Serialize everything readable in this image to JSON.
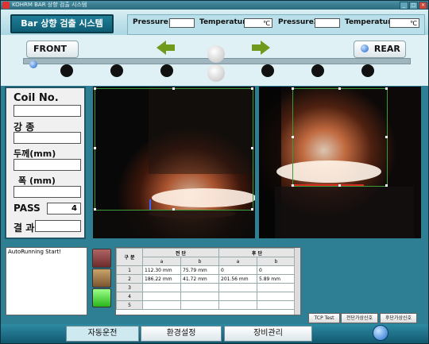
{
  "window": {
    "title": "KOHRM BAR 상향 검출 시스템"
  },
  "app_title": "Bar 상향 검출 시스템",
  "readouts": {
    "pressure1_label": "Pressure1",
    "pressure1_value": "",
    "temperature1_label": "Temperature1",
    "temperature1_unit": "℃",
    "pressure2_label": "Pressure2",
    "pressure2_value": "",
    "temperature2_label": "Temperature2",
    "temperature2_unit": "℃"
  },
  "nav": {
    "front_label": "FRONT",
    "rear_label": "REAR"
  },
  "info": {
    "coil_label": "Coil No.",
    "coil_value": "",
    "grade_label": "강    종",
    "grade_value": "",
    "thickness_label": "두께(mm)",
    "thickness_value": "",
    "width_label": "폭  (mm)",
    "width_value": "",
    "pass_label": "PASS",
    "pass_value": "4",
    "result_label": "결  과",
    "result_value": ""
  },
  "log": {
    "text": "AutoRunning Start!"
  },
  "table": {
    "col_group": "구 분",
    "front_label": "전 단",
    "rear_label": "후 단",
    "sub_a": "a",
    "sub_b": "b",
    "rows": [
      {
        "no": "1",
        "fa": "112.30 mm",
        "fb": "75.79 mm",
        "ra": "0",
        "rb": "0"
      },
      {
        "no": "2",
        "fa": "186.22 mm",
        "fb": "41.72 mm",
        "ra": "201.56 mm",
        "rb": "5.89 mm"
      },
      {
        "no": "3",
        "fa": "",
        "fb": "",
        "ra": "",
        "rb": ""
      },
      {
        "no": "4",
        "fa": "",
        "fb": "",
        "ra": "",
        "rb": ""
      },
      {
        "no": "5",
        "fa": "",
        "fb": "",
        "ra": "",
        "rb": ""
      }
    ]
  },
  "small_buttons": {
    "tcp": "TCP Test",
    "front_signal": "전단가상신호",
    "rear_signal": "후단가상신호"
  },
  "tabs": {
    "auto": "자동운전",
    "env": "환경설정",
    "equip": "장비관리"
  },
  "colors": {
    "accent": "#2f7f94",
    "selection": "#3a9b3a",
    "arrow": "#6f9a1c",
    "swatch1": "#8a3a3a",
    "swatch2": "#9c7a4a",
    "swatch3": "#3fcf2a"
  }
}
